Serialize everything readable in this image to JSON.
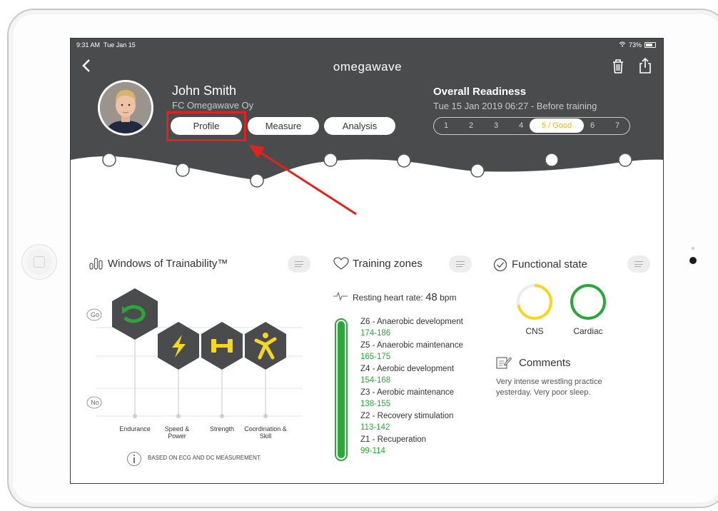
{
  "status": {
    "time": "9:31 AM",
    "date": "Tue Jan 15",
    "battery": "73%"
  },
  "header": {
    "logo": "omegawave",
    "athlete_name": "John Smith",
    "club": "FC Omegawave Oy",
    "tabs": [
      {
        "label": "Profile"
      },
      {
        "label": "Measure"
      },
      {
        "label": "Analysis"
      }
    ],
    "readiness_title": "Overall Readiness",
    "readiness_sub": "Tue 15 Jan 2019 06:27 - Before training",
    "scale": [
      "1",
      "2",
      "3",
      "4",
      "5 / Good",
      "6",
      "7"
    ]
  },
  "windows": {
    "title": "Windows of Trainability™",
    "go": "Go",
    "no": "No",
    "columns": [
      {
        "label": "Endurance",
        "icon": "cycle-icon",
        "icon_color": "#2aa63a"
      },
      {
        "label": "Speed & Power",
        "icon": "lightning-icon",
        "icon_color": "#f5d623"
      },
      {
        "label": "Strength",
        "icon": "dumbbell-icon",
        "icon_color": "#f5d623"
      },
      {
        "label": "Coordination & Skill",
        "icon": "person-icon",
        "icon_color": "#f5d623"
      }
    ],
    "note": "BASED ON ECG AND DC MEASUREMENT."
  },
  "training_zones": {
    "title": "Training zones",
    "resting_label": "Resting heart rate:",
    "resting_value": "48",
    "resting_unit": "bpm",
    "zones": [
      {
        "name": "Z6 - Anaerobic development",
        "range": "174-186"
      },
      {
        "name": "Z5 - Anaerobic maintenance",
        "range": "165-175"
      },
      {
        "name": "Z4 - Aerobic development",
        "range": "154-168"
      },
      {
        "name": "Z3 - Aerobic maintenance",
        "range": "138-155"
      },
      {
        "name": "Z2 - Recovery stimulation",
        "range": "113-142"
      },
      {
        "name": "Z1 - Recuperation",
        "range": "99-114"
      }
    ]
  },
  "functional_state": {
    "title": "Functional state",
    "cns": {
      "label": "CNS",
      "level": 0.72,
      "color": "#f5d623"
    },
    "cardiac": {
      "label": "Cardiac",
      "level": 1.0,
      "color": "#2aa63a"
    },
    "comments_title": "Comments",
    "comments_text": "Very intense wrestling practice yesterday. Very poor sleep."
  },
  "colors": {
    "header": "#4a4b4d",
    "accent_red": "#e0231f",
    "good": "#f0b400"
  }
}
